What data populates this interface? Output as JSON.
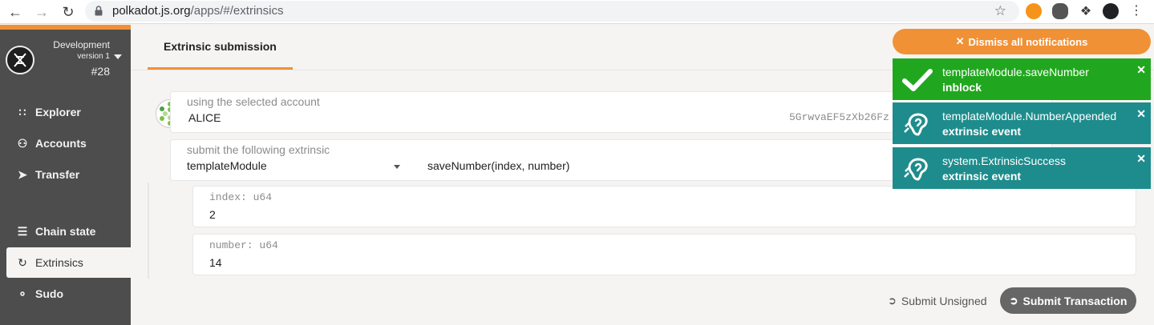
{
  "browser": {
    "url_host": "polkadot.js.org",
    "url_path": "/apps/#/extrinsics"
  },
  "sidebar": {
    "chain_name": "Development",
    "chain_version": "version 1",
    "block_number": "#28",
    "items": [
      {
        "label": "Explorer",
        "icon": "grid-icon"
      },
      {
        "label": "Accounts",
        "icon": "users-icon"
      },
      {
        "label": "Transfer",
        "icon": "send-icon"
      },
      {
        "label": "Chain state",
        "icon": "database-icon"
      },
      {
        "label": "Extrinsics",
        "icon": "sync-icon"
      },
      {
        "label": "Sudo",
        "icon": "unlock-icon"
      }
    ]
  },
  "main": {
    "tab": "Extrinsic submission",
    "account_label": "using the selected account",
    "account_name": "ALICE",
    "account_address": "5GrwvaEF5zXb26Fz",
    "extrinsic_label": "submit the following extrinsic",
    "module": "templateModule",
    "method": "saveNumber(index, number)",
    "params": [
      {
        "label": "index: u64",
        "value": "2"
      },
      {
        "label": "number: u64",
        "value": "14"
      }
    ],
    "submit_unsigned": "Submit Unsigned",
    "submit_transaction": "Submit Transaction"
  },
  "notifications": {
    "dismiss_all": "Dismiss all notifications",
    "items": [
      {
        "title": "templateModule.saveNumber",
        "status": "inblock",
        "color": "#21a71f",
        "icon": "check-icon"
      },
      {
        "title": "templateModule.NumberAppended",
        "status": "extrinsic event",
        "color": "#1e8c8c",
        "icon": "ear-icon"
      },
      {
        "title": "system.ExtrinsicSuccess",
        "status": "extrinsic event",
        "color": "#1e8c8c",
        "icon": "ear-icon"
      }
    ]
  },
  "colors": {
    "accent": "#f19135",
    "sidebar": "#4d4d4d",
    "success": "#21a71f",
    "event": "#1e8c8c"
  }
}
